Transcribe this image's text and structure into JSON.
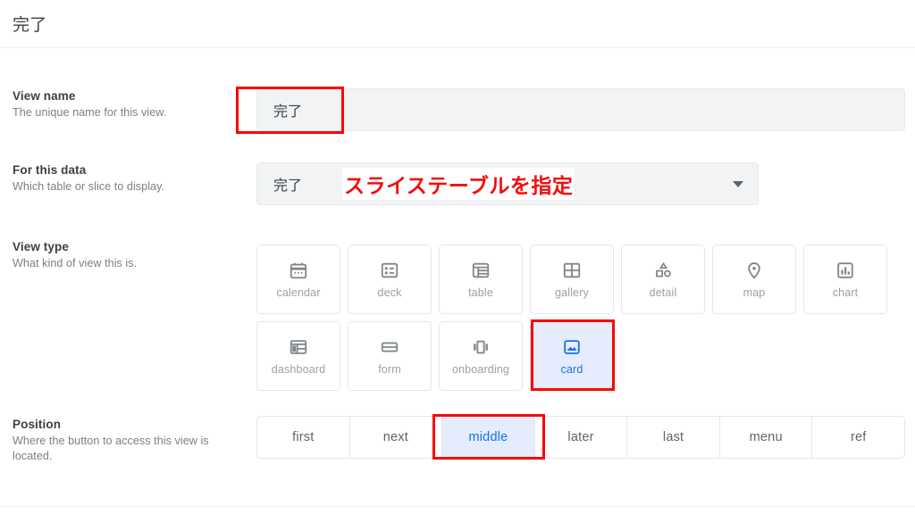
{
  "header": {
    "title": "完了"
  },
  "rows": {
    "view_name": {
      "label": "View name",
      "description": "The unique name for this view.",
      "value": "完了",
      "placeholder": ""
    },
    "for_this_data": {
      "label": "For this data",
      "description": "Which table or slice to display.",
      "value": "完了",
      "annotation": "スライステーブルを指定",
      "annotation_color": "#f20d0d",
      "dropdown_icon": "chevron-down-icon"
    },
    "view_type": {
      "label": "View type",
      "description": "What kind of view this is.",
      "selected": "card",
      "accent_color": "#1a73e8",
      "tiles": [
        {
          "label": "calendar",
          "icon": "calendar-icon"
        },
        {
          "label": "deck",
          "icon": "deck-icon"
        },
        {
          "label": "table",
          "icon": "table-icon"
        },
        {
          "label": "gallery",
          "icon": "gallery-icon"
        },
        {
          "label": "detail",
          "icon": "detail-icon"
        },
        {
          "label": "map",
          "icon": "map-pin-icon"
        },
        {
          "label": "chart",
          "icon": "chart-icon"
        },
        {
          "label": "dashboard",
          "icon": "dashboard-icon"
        },
        {
          "label": "form",
          "icon": "form-icon"
        },
        {
          "label": "onboarding",
          "icon": "onboarding-icon"
        },
        {
          "label": "card",
          "icon": "card-image-icon"
        }
      ]
    },
    "position": {
      "label": "Position",
      "description": "Where the button to access this view is located.",
      "selected": "middle",
      "options": [
        "first",
        "next",
        "middle",
        "later",
        "last",
        "menu",
        "ref"
      ]
    }
  },
  "annotations": [
    {
      "name": "view-name-value-highlight",
      "color": "#fb0505"
    },
    {
      "name": "card-tile-highlight",
      "color": "#fb0505"
    },
    {
      "name": "middle-position-highlight",
      "color": "#fb0505"
    }
  ]
}
